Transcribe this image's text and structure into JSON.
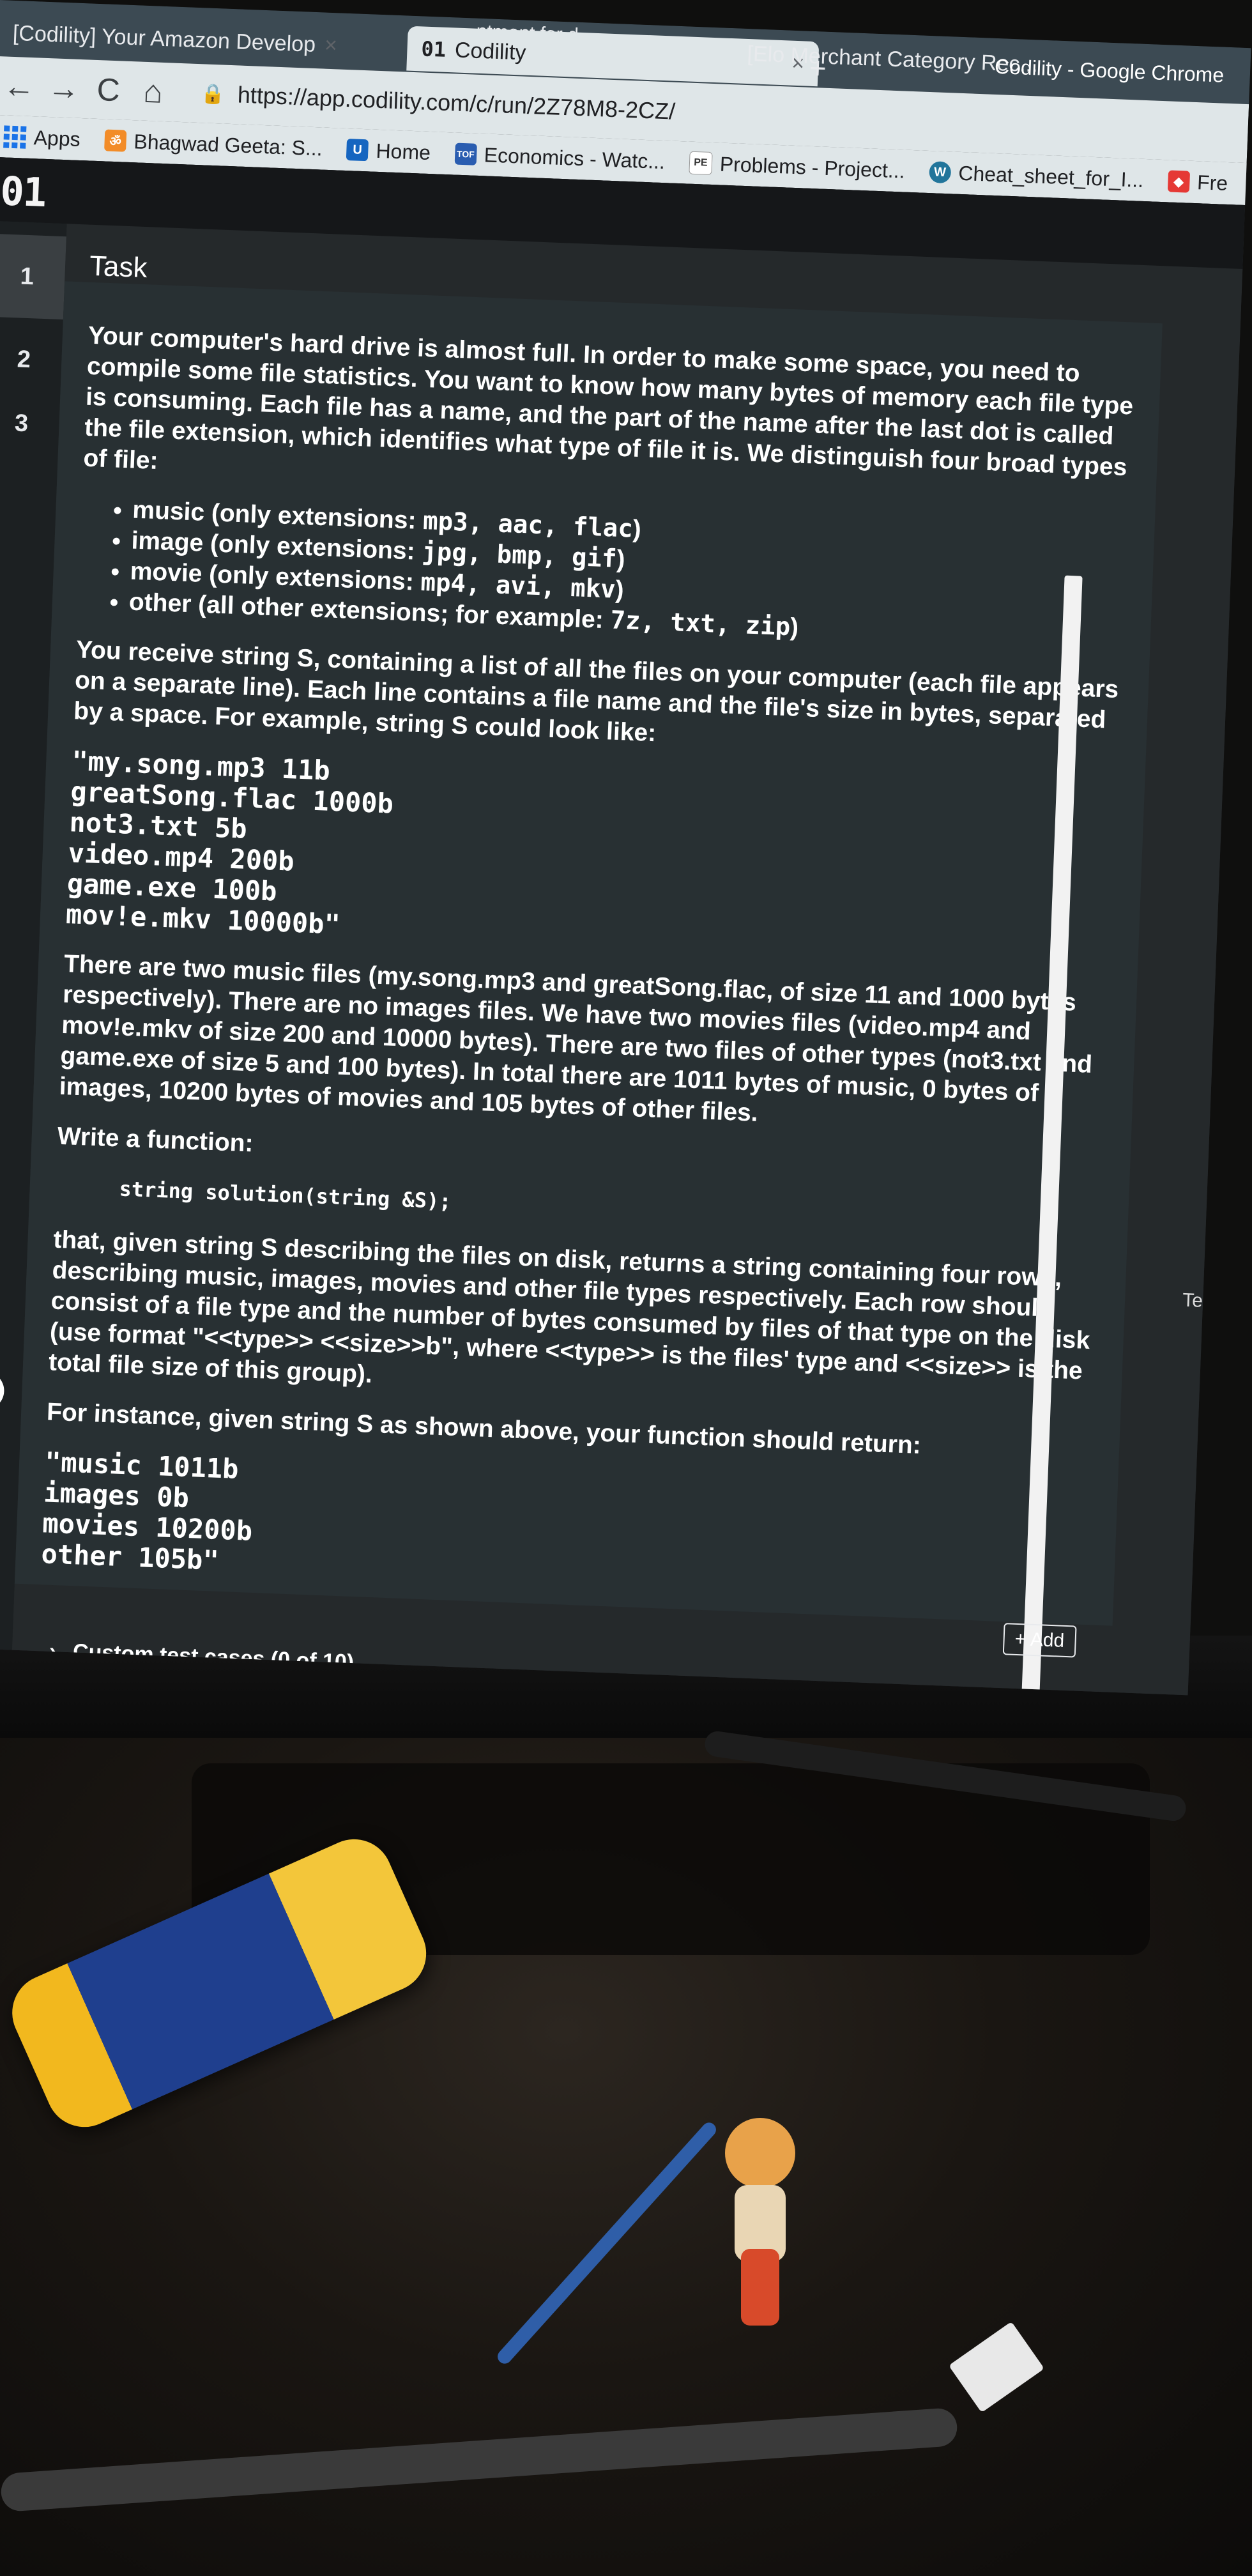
{
  "browser": {
    "window_title": "Codility - Google Chrome",
    "tabs": [
      {
        "label": "[Codility] Your Amazon Develop",
        "active": false
      },
      {
        "label": "...ntment for d...",
        "active": false
      },
      {
        "label": "Codility",
        "prefix": "01",
        "active": true
      },
      {
        "label": "[Elo Merchant Category Rec...",
        "active": false
      }
    ],
    "close_glyph": "×",
    "new_tab_glyph": "+",
    "url": "https://app.codility.com/c/run/2Z78M8-2CZ/",
    "nav": {
      "back": "←",
      "forward": "→",
      "reload": "C",
      "home": "⌂"
    },
    "bookmarks": [
      {
        "label": "Apps",
        "icon": "apps-grid-icon"
      },
      {
        "label": "Bhagwad Geeta: S...",
        "icon": "om-icon"
      },
      {
        "label": "Home",
        "icon": "udacity-icon"
      },
      {
        "label": "Economics - Watc...",
        "icon": "tof-icon"
      },
      {
        "label": "Problems - Project...",
        "icon": "project-euler-icon"
      },
      {
        "label": "Cheat_sheet_for_I...",
        "icon": "wordpress-icon"
      },
      {
        "label": "Fre",
        "icon": "bookmark-icon"
      }
    ]
  },
  "app": {
    "logo": "01",
    "task_numbers": [
      "1",
      "2",
      "3"
    ],
    "active_task": "1",
    "task_tab": "Task",
    "intro": "Your computer's hard drive is almost full. In order to make some space, you need to compile some file statistics. You want to know how many bytes of memory each file type is consuming. Each file has a name, and the part of the name after the last dot is called the file extension, which identifies what type of file it is. We distinguish four broad types of file:",
    "types": [
      {
        "text": "music (only extensions: ",
        "code": "mp3, aac, flac",
        "after": ")"
      },
      {
        "text": "image (only extensions: ",
        "code": "jpg, bmp, gif",
        "after": ")"
      },
      {
        "text": "movie (only extensions: ",
        "code": "mp4, avi, mkv",
        "after": ")"
      },
      {
        "text": "other (all other extensions; for example: ",
        "code": "7z, txt, zip",
        "after": ")"
      }
    ],
    "receive": "You receive string S, containing a list of all the files on your computer (each file appears on a separate line). Each line contains a file name and the file's size in bytes, separated by a space. For example, string S could look like:",
    "example_input": "\"my.song.mp3 11b\ngreatSong.flac 1000b\nnot3.txt 5b\nvideo.mp4 200b\ngame.exe 100b\nmov!e.mkv 10000b\"",
    "explanation": "There are two music files (my.song.mp3 and greatSong.flac, of size 11 and 1000 bytes respectively). There are no images files. We have two movies files (video.mp4 and mov!e.mkv of size 200 and 10000 bytes). There are two files of other types (not3.txt and game.exe of size 5 and 100 bytes). In total there are 1011 bytes of music, 0 bytes of images, 10200 bytes of movies and 105 bytes of other files.",
    "write_function": "Write a function:",
    "signature": "string solution(string &S);",
    "description": "that, given string S describing the files on disk, returns a string containing four rows, describing music, images, movies and other file types respectively. Each row should consist of a file type and the number of bytes consumed by files of that type on the disk (use format \"<<type>> <<size>>b\", where <<type>> is the files' type and <<size>> is the total file size of this group).",
    "for_instance": "For instance, given string S as shown above, your function should return:",
    "example_output": "\"music 1011b\nimages 0b\nmovies 10200b\nother 105b\"",
    "add_button": "+ Add",
    "custom_tests": "Custom test cases (0 of 10)",
    "custom_tests_chevron": "›",
    "side_label": "Te"
  }
}
